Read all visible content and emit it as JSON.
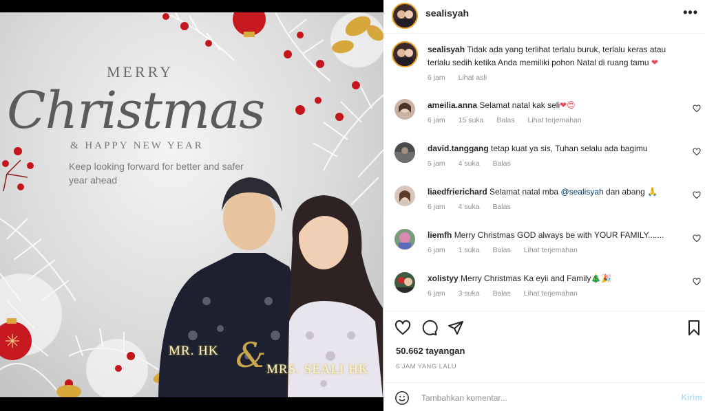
{
  "post": {
    "image": {
      "merry": "MERRY",
      "christmas": "Christmas",
      "happy": "& HAPPY NEW YEAR",
      "tagline": "Keep looking forward for better and safer year ahead",
      "name_mr": "MR. HK",
      "ampersand": "&",
      "name_mrs": "MRS. SEALI HK"
    }
  },
  "header": {
    "username": "sealisyah",
    "more": "•••"
  },
  "caption": {
    "username": "sealisyah",
    "text": "Tidak ada yang terlihat terlalu buruk, terlalu keras atau terlalu sedih ketika Anda memiliki pohon Natal di ruang tamu",
    "emoji": "❤",
    "time": "6 jam",
    "see_translation": "Lihat asli"
  },
  "comments": [
    {
      "username": "ameilia.anna",
      "text": "Selamat natal kak seli",
      "emoji": "❤😍",
      "time": "6 jam",
      "likes": "15 suka",
      "reply": "Balas",
      "translate": "Lihat terjemahan"
    },
    {
      "username": "david.tanggang",
      "text": "tetap kuat ya sis, Tuhan selalu ada bagimu",
      "emoji": "",
      "time": "5 jam",
      "likes": "4 suka",
      "reply": "Balas",
      "translate": ""
    },
    {
      "username": "liaedfrierichard",
      "text": "Selamat natal mba",
      "mention": "@sealisyah",
      "text2": "dan abang",
      "emoji": "🙏",
      "time": "6 jam",
      "likes": "4 suka",
      "reply": "Balas",
      "translate": ""
    },
    {
      "username": "liemfh",
      "text": "Merry Christmas GOD always be with YOUR FAMILY.......",
      "emoji": "",
      "time": "6 jam",
      "likes": "1 suka",
      "reply": "Balas",
      "translate": "Lihat terjemahan"
    },
    {
      "username": "xolistyy",
      "text": "Merry Christmas Ka eyii and Family",
      "emoji": "🎄🎉",
      "time": "6 jam",
      "likes": "3 suka",
      "reply": "Balas",
      "translate": "Lihat terjemahan"
    }
  ],
  "actions": {
    "icons": [
      "heart-icon",
      "comment-icon",
      "share-icon",
      "bookmark-icon"
    ],
    "views": "50.662 tayangan",
    "ago": "6 JAM YANG LALU"
  },
  "add_comment": {
    "placeholder": "Tambahkan komentar...",
    "send": "Kirim"
  },
  "colors": {
    "accent": "#0095f6",
    "send_disabled": "#b2dffc",
    "meta": "#8e8e8e",
    "like": "#ed4956"
  }
}
